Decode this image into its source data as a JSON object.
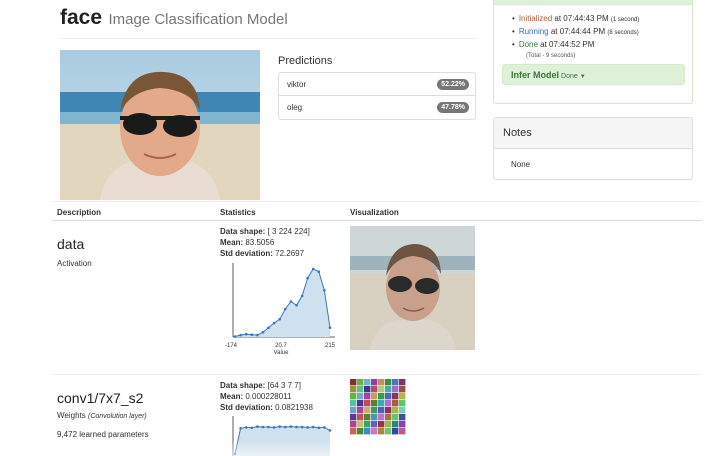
{
  "header": {
    "title": "face",
    "subtitle": "Image Classification Model"
  },
  "predictions": {
    "heading": "Predictions",
    "items": [
      {
        "label": "viktor",
        "value": "52.22%"
      },
      {
        "label": "oleg",
        "value": "47.78%"
      }
    ]
  },
  "job_status": {
    "items": [
      {
        "state": "Initialized",
        "text": " at 07:44:43 PM",
        "duration": "(1 second)"
      },
      {
        "state": "Running",
        "text": " at 07:44:44 PM",
        "duration": "(8 seconds)"
      },
      {
        "state": "Done",
        "text": " at 07:44:52 PM",
        "duration": ""
      }
    ],
    "total": "(Total - 9 seconds)",
    "infer_button": {
      "label": "Infer Model",
      "state": "Done"
    }
  },
  "notes": {
    "heading": "Notes",
    "text": "None"
  },
  "table": {
    "col_description": "Description",
    "col_statistics": "Statistics",
    "col_visualization": "Visualization"
  },
  "layers": [
    {
      "name": "data",
      "type": "Activation",
      "type_detail": "",
      "params": "",
      "stats": {
        "shape_label": "Data shape:",
        "shape": "[ 3 224 224]",
        "mean_label": "Mean:",
        "mean": "83.5056",
        "std_label": "Std deviation:",
        "std": "72.2697"
      },
      "histogram": {
        "tick_labels": [
          "-174",
          "20.7",
          "215"
        ],
        "xlabel": "Value",
        "values": [
          0.5,
          2,
          3,
          2.5,
          2,
          5,
          10,
          15,
          19,
          30,
          38,
          34,
          44,
          63,
          73,
          70,
          50,
          10
        ]
      }
    },
    {
      "name": "conv1/7x7_s2",
      "type": "Weights",
      "type_detail": "(Convolution layer)",
      "params": "9,472 learned parameters",
      "stats": {
        "shape_label": "Data shape:",
        "shape": "[64 3 7 7]",
        "mean_label": "Mean:",
        "mean": "0.000228011",
        "std_label": "Std deviation:",
        "std": "0.0821938"
      },
      "histogram": {
        "values": [
          5,
          65,
          67,
          66,
          69,
          68,
          68,
          67,
          69,
          68,
          69,
          68,
          68,
          67,
          68,
          66,
          67,
          60
        ]
      }
    }
  ],
  "colors": {
    "success_bg": "#dff0d8",
    "success_text": "#3c763d",
    "badge": "#777777",
    "hist_fill": "#cfe0ee",
    "hist_line": "#3a78b8"
  }
}
